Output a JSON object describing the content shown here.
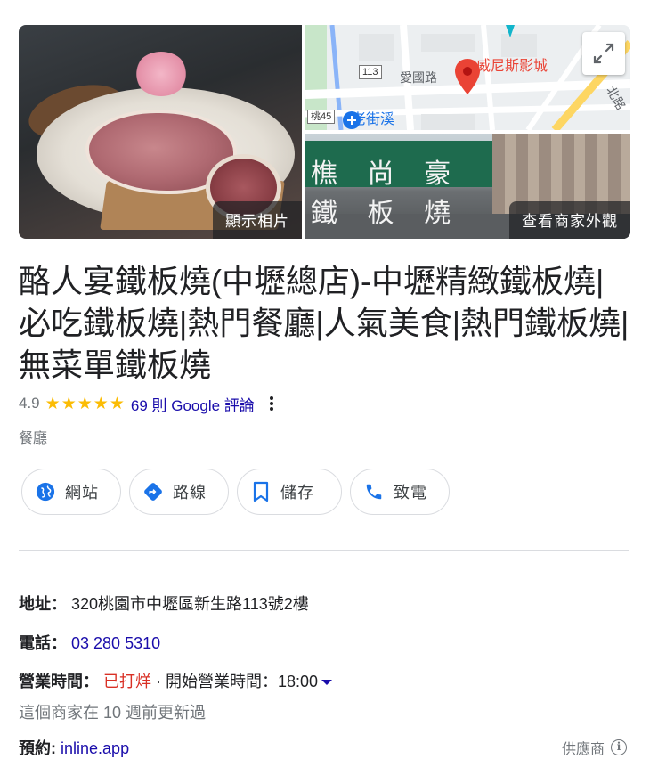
{
  "photos": {
    "show_photos_label": "顯示相片",
    "storefront_label": "查看商家外觀",
    "street_sign_text": "樵 尚 豪 鐵 板 燒"
  },
  "map": {
    "poi_label": "威尼斯影城",
    "road_aiguo": "愛國路",
    "route_113": "113",
    "route_tao45": "桃45",
    "old_street_label": "老街溪",
    "road_edge": "北路",
    "accent_color": "#ea4335"
  },
  "business": {
    "title": "酪人宴鐵板燒(中壢總店)-中壢精緻鐵板燒|必吃鐵板燒|熱門餐廳|人氣美食|熱門鐵板燒|無菜單鐵板燒",
    "rating": "4.9",
    "stars": 5,
    "reviews_text": "69 則 Google 評論",
    "category": "餐廳"
  },
  "actions": [
    {
      "label": "網站",
      "icon": "globe-icon"
    },
    {
      "label": "路線",
      "icon": "directions-icon"
    },
    {
      "label": "儲存",
      "icon": "bookmark-icon"
    },
    {
      "label": "致電",
      "icon": "phone-icon"
    }
  ],
  "details": {
    "address_key": "地址：",
    "address_value": "320桃園市中壢區新生路113號2樓",
    "phone_key": "電話：",
    "phone_value": "03 280 5310",
    "hours_key": "營業時間：",
    "hours_status": "已打烊",
    "hours_next": "· 開始營業時間：18:00",
    "updated_note": "這個商家在 10 週前更新過",
    "booking_key": "預約:",
    "booking_value": "inline.app",
    "provider_label": "供應商"
  },
  "colors": {
    "link": "#1a0dab",
    "star": "#fbbc04",
    "closed": "#d93025",
    "action_icon": "#1a73e8"
  }
}
